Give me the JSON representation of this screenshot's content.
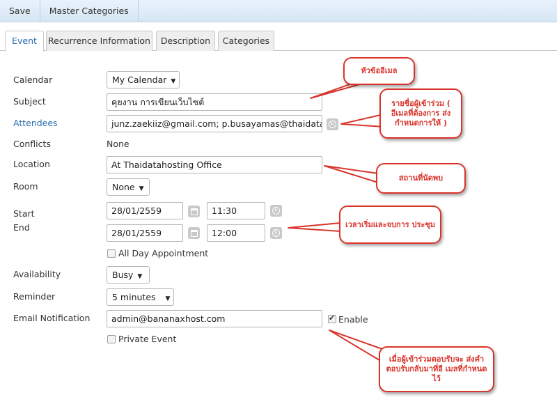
{
  "toolbar": {
    "save_label": "Save",
    "master_categories_label": "Master Categories"
  },
  "tabs": [
    {
      "label": "Event",
      "active": true
    },
    {
      "label": "Recurrence Information",
      "active": false
    },
    {
      "label": "Description",
      "active": false
    },
    {
      "label": "Categories",
      "active": false
    }
  ],
  "form": {
    "calendar": {
      "label": "Calendar",
      "value": "My Calendar"
    },
    "subject": {
      "label": "Subject",
      "value": "คุยงาน การเขียนเว็บไซต์"
    },
    "attendees": {
      "label": "Attendees",
      "value": "junz.zaekiiz@gmail.com; p.busayamas@thaidatahosting.com"
    },
    "conflicts": {
      "label": "Conflicts",
      "value": "None"
    },
    "location": {
      "label": "Location",
      "value": "At Thaidatahosting Office"
    },
    "room": {
      "label": "Room",
      "value": "None"
    },
    "start": {
      "label": "Start",
      "date": "28/01/2559",
      "time": "11:30"
    },
    "end": {
      "label": "End",
      "date": "28/01/2559",
      "time": "12:00"
    },
    "all_day": {
      "label": "All Day Appointment",
      "checked": false
    },
    "availability": {
      "label": "Availability",
      "value": "Busy"
    },
    "reminder": {
      "label": "Reminder",
      "value": "5 minutes"
    },
    "email_notification": {
      "label": "Email Notification",
      "value": "admin@bananaxhost.com"
    },
    "enable": {
      "label": "Enable",
      "checked": true
    },
    "private_event": {
      "label": "Private Event",
      "checked": false
    }
  },
  "annotations": {
    "subject_note": "หัวข้ออีเมล",
    "attendees_note": "รายชื่อผู้เข้าร่วม ( อีเมลที่ต้องการ ส่งกำหนดการให้ )",
    "location_note": "สถานที่นัดพบ",
    "time_note": "เวลาเริ่มและจบการ ประชุม",
    "notify_note": "เมื่อผู้เข้าร่วมตอบรับจะ ส่งคำตอบรับกลับมาที่อี เมลที่กำหนดไว้"
  },
  "colors": {
    "accent": "#2a6fb0",
    "annotation": "#d9342b",
    "toolbar": "#dce9f6"
  }
}
